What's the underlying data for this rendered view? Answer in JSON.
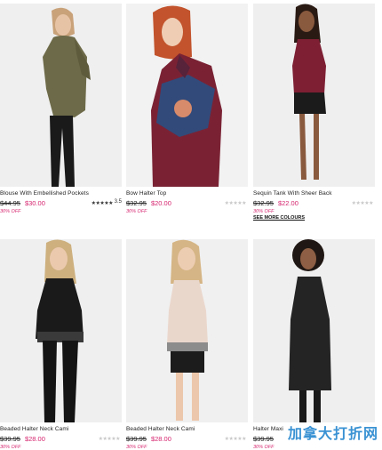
{
  "products": [
    {
      "name": "Blouse With Embellished Pockets",
      "old_price": "$44.95",
      "new_price": "$30.00",
      "discount": "30% OFF",
      "rating_count": "3.5",
      "colours_link": ""
    },
    {
      "name": "Bow Halter Top",
      "old_price": "$32.95",
      "new_price": "$20.00",
      "discount": "30% OFF",
      "rating_count": "",
      "colours_link": ""
    },
    {
      "name": "Sequin Tank With Sheer Back",
      "old_price": "$32.95",
      "new_price": "$22.00",
      "discount": "30% OFF",
      "rating_count": "",
      "colours_link": "SEE MORE COLOURS"
    },
    {
      "name": "Beaded Halter Neck Cami",
      "old_price": "$39.95",
      "new_price": "$28.00",
      "discount": "30% OFF",
      "rating_count": "",
      "colours_link": ""
    },
    {
      "name": "Beaded Halter Neck Cami",
      "old_price": "$39.95",
      "new_price": "$28.00",
      "discount": "30% OFF",
      "rating_count": "",
      "colours_link": ""
    },
    {
      "name": "Halter Maxi",
      "old_price": "$39.95",
      "new_price": "",
      "discount": "30% OFF",
      "rating_count": "",
      "colours_link": ""
    }
  ],
  "stars_glyph": "★★★★★",
  "watermark": "加拿大打折网",
  "colors": {
    "sale_price": "#d6246e",
    "watermark": "#3a92d3"
  }
}
